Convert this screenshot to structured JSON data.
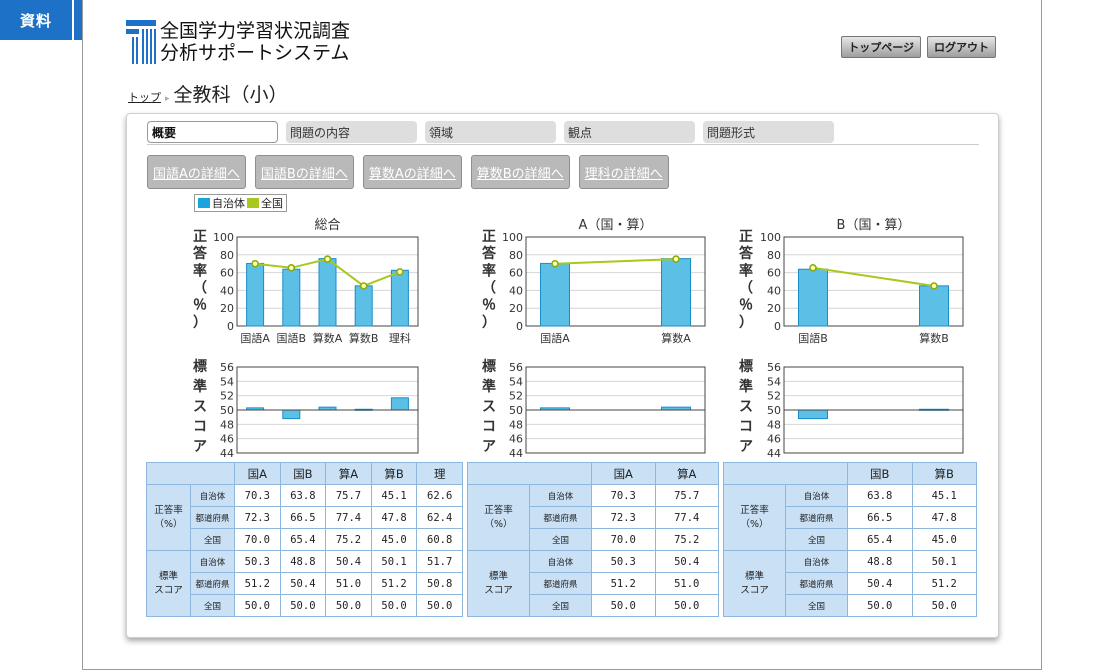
{
  "badge": {
    "label": "資料",
    "number": "1"
  },
  "header": {
    "system_name_line1": "全国学力学習状況調査",
    "system_name_line2": "分析サポートシステム",
    "top_page_button": "トップページ",
    "logout_button": "ログアウト"
  },
  "breadcrumb": {
    "top": "トップ",
    "sep": "▸",
    "title": "全教科（小）"
  },
  "tabs": [
    "概要",
    "問題の内容",
    "領域",
    "観点",
    "問題形式"
  ],
  "detail_buttons": [
    "国語Aの詳細へ",
    "国語Bの詳細へ",
    "算数Aの詳細へ",
    "算数Bの詳細へ",
    "理科の詳細へ"
  ],
  "legend": {
    "local": "自治体",
    "national": "全国"
  },
  "colors": {
    "bar": "#5cbfe6",
    "bar_stroke": "#1a8ec9",
    "line": "#a8c81e",
    "marker_fill": "#ffffaa",
    "table_header": "#c9e0f5",
    "badge": "#1d72c7"
  },
  "chart_data": [
    {
      "type": "bar",
      "title": "総合",
      "ylabel": "正答率（％）",
      "categories": [
        "国語A",
        "国語B",
        "算数A",
        "算数B",
        "理科"
      ],
      "ylim": [
        0,
        100
      ],
      "yticks": [
        0,
        20,
        40,
        60,
        80,
        100
      ],
      "series": [
        {
          "name": "自治体",
          "type": "bar",
          "values": [
            70.3,
            63.8,
            75.7,
            45.1,
            62.6
          ]
        },
        {
          "name": "全国",
          "type": "line",
          "values": [
            70.0,
            65.4,
            75.2,
            45.0,
            60.8
          ]
        }
      ]
    },
    {
      "type": "bar",
      "title": "A（国・算）",
      "ylabel": "正答率（％）",
      "categories": [
        "国語A",
        "算数A"
      ],
      "ylim": [
        0,
        100
      ],
      "yticks": [
        0,
        20,
        40,
        60,
        80,
        100
      ],
      "series": [
        {
          "name": "自治体",
          "type": "bar",
          "values": [
            70.3,
            75.7
          ]
        },
        {
          "name": "全国",
          "type": "line",
          "values": [
            70.0,
            75.2
          ]
        }
      ]
    },
    {
      "type": "bar",
      "title": "B（国・算）",
      "ylabel": "正答率（％）",
      "categories": [
        "国語B",
        "算数B"
      ],
      "ylim": [
        0,
        100
      ],
      "yticks": [
        0,
        20,
        40,
        60,
        80,
        100
      ],
      "series": [
        {
          "name": "自治体",
          "type": "bar",
          "values": [
            63.8,
            45.1
          ]
        },
        {
          "name": "全国",
          "type": "line",
          "values": [
            65.4,
            45.0
          ]
        }
      ]
    },
    {
      "type": "bar",
      "ylabel": "標準スコア",
      "categories": [
        "国語A",
        "国語B",
        "算数A",
        "算数B",
        "理科"
      ],
      "ylim": [
        44,
        56
      ],
      "yticks": [
        44,
        46,
        48,
        50,
        52,
        54,
        56
      ],
      "baseline": 50,
      "series": [
        {
          "name": "自治体",
          "values": [
            50.3,
            48.8,
            50.4,
            50.1,
            51.7
          ]
        }
      ]
    },
    {
      "type": "bar",
      "ylabel": "標準スコア",
      "categories": [
        "国語A",
        "算数A"
      ],
      "ylim": [
        44,
        56
      ],
      "yticks": [
        44,
        46,
        48,
        50,
        52,
        54,
        56
      ],
      "baseline": 50,
      "series": [
        {
          "name": "自治体",
          "values": [
            50.3,
            50.4
          ]
        }
      ]
    },
    {
      "type": "bar",
      "ylabel": "標準スコア",
      "categories": [
        "国語B",
        "算数B"
      ],
      "ylim": [
        44,
        56
      ],
      "yticks": [
        44,
        46,
        48,
        50,
        52,
        54,
        56
      ],
      "baseline": 50,
      "series": [
        {
          "name": "自治体",
          "values": [
            48.8,
            50.1
          ]
        }
      ]
    }
  ],
  "tables": [
    {
      "columns": [
        "国A",
        "国B",
        "算A",
        "算B",
        "理"
      ],
      "groups": [
        {
          "label": "正答率\n（%）",
          "rows": [
            {
              "label": "自治体",
              "values": [
                "70.3",
                "63.8",
                "75.7",
                "45.1",
                "62.6"
              ]
            },
            {
              "label": "都道府県",
              "values": [
                "72.3",
                "66.5",
                "77.4",
                "47.8",
                "62.4"
              ]
            },
            {
              "label": "全国",
              "values": [
                "70.0",
                "65.4",
                "75.2",
                "45.0",
                "60.8"
              ]
            }
          ]
        },
        {
          "label": "標準\nスコア",
          "rows": [
            {
              "label": "自治体",
              "values": [
                "50.3",
                "48.8",
                "50.4",
                "50.1",
                "51.7"
              ]
            },
            {
              "label": "都道府県",
              "values": [
                "51.2",
                "50.4",
                "51.0",
                "51.2",
                "50.8"
              ]
            },
            {
              "label": "全国",
              "values": [
                "50.0",
                "50.0",
                "50.0",
                "50.0",
                "50.0"
              ]
            }
          ]
        }
      ]
    },
    {
      "columns": [
        "国A",
        "算A"
      ],
      "groups": [
        {
          "label": "正答率\n（%）",
          "rows": [
            {
              "label": "自治体",
              "values": [
                "70.3",
                "75.7"
              ]
            },
            {
              "label": "都道府県",
              "values": [
                "72.3",
                "77.4"
              ]
            },
            {
              "label": "全国",
              "values": [
                "70.0",
                "75.2"
              ]
            }
          ]
        },
        {
          "label": "標準\nスコア",
          "rows": [
            {
              "label": "自治体",
              "values": [
                "50.3",
                "50.4"
              ]
            },
            {
              "label": "都道府県",
              "values": [
                "51.2",
                "51.0"
              ]
            },
            {
              "label": "全国",
              "values": [
                "50.0",
                "50.0"
              ]
            }
          ]
        }
      ]
    },
    {
      "columns": [
        "国B",
        "算B"
      ],
      "groups": [
        {
          "label": "正答率\n（%）",
          "rows": [
            {
              "label": "自治体",
              "values": [
                "63.8",
                "45.1"
              ]
            },
            {
              "label": "都道府県",
              "values": [
                "66.5",
                "47.8"
              ]
            },
            {
              "label": "全国",
              "values": [
                "65.4",
                "45.0"
              ]
            }
          ]
        },
        {
          "label": "標準\nスコア",
          "rows": [
            {
              "label": "自治体",
              "values": [
                "48.8",
                "50.1"
              ]
            },
            {
              "label": "都道府県",
              "values": [
                "50.4",
                "51.2"
              ]
            },
            {
              "label": "全国",
              "values": [
                "50.0",
                "50.0"
              ]
            }
          ]
        }
      ]
    }
  ]
}
